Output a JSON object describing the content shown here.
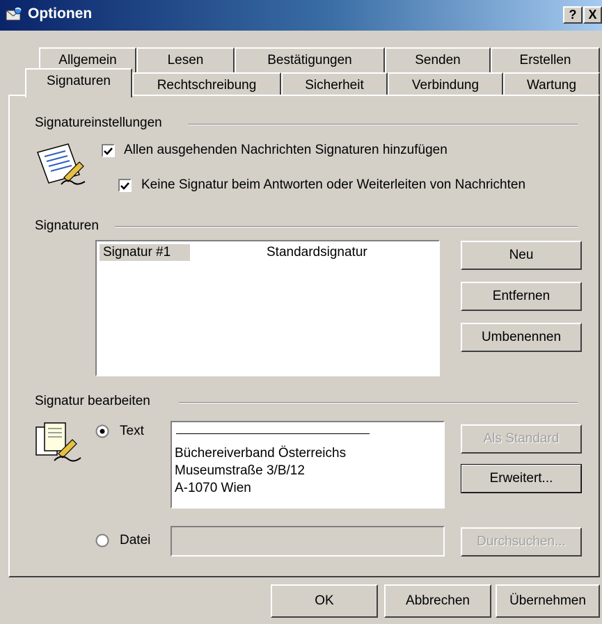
{
  "window": {
    "title": "Optionen",
    "help_button": "?",
    "close_button": "X"
  },
  "tabs": {
    "row_back": [
      "Allgemein",
      "Lesen",
      "Bestätigungen",
      "Senden",
      "Erstellen"
    ],
    "row_front": [
      "Signaturen",
      "Rechtschreibung",
      "Sicherheit",
      "Verbindung",
      "Wartung"
    ],
    "active": "Signaturen"
  },
  "signature_settings": {
    "heading": "Signatureinstellungen",
    "add_to_all_label": "Allen ausgehenden Nachrichten Signaturen hinzufügen",
    "add_to_all_checked": true,
    "no_reply_forward_label": "Keine Signatur beim Antworten oder Weiterleiten von Nachrichten",
    "no_reply_forward_checked": true
  },
  "signatures": {
    "heading": "Signaturen",
    "list": [
      {
        "name": "Signatur #1",
        "note": "Standardsignatur",
        "selected": true
      }
    ],
    "new_button": "Neu",
    "remove_button": "Entfernen",
    "rename_button": "Umbenennen"
  },
  "edit_signature": {
    "heading": "Signatur bearbeiten",
    "text_option_label": "Text",
    "text_option_selected": true,
    "text_lines": [
      "Büchereiverband Österreichs",
      "Museumstraße 3/B/12",
      "A-1070 Wien"
    ],
    "file_option_label": "Datei",
    "file_path": "",
    "set_default_button": "Als Standard",
    "advanced_button": "Erweitert...",
    "browse_button": "Durchsuchen..."
  },
  "footer": {
    "ok_button": "OK",
    "cancel_button": "Abbrechen",
    "apply_button": "Übernehmen"
  }
}
